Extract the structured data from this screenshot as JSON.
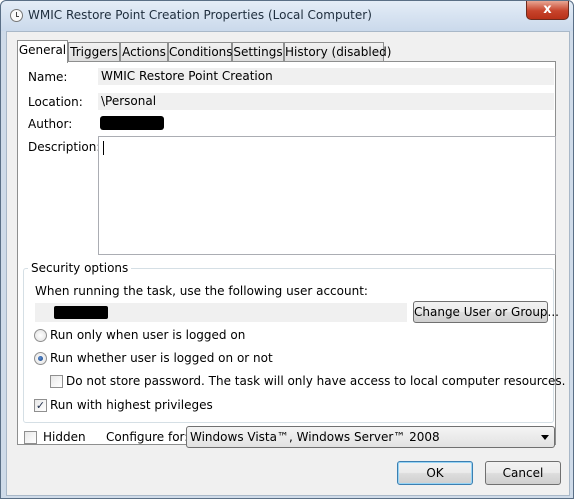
{
  "window": {
    "title": "WMIC Restore Point Creation Properties (Local Computer)",
    "close_glyph": "x",
    "title_icon": "task-clock-icon"
  },
  "tabs": [
    {
      "label": "General",
      "active": true
    },
    {
      "label": "Triggers"
    },
    {
      "label": "Actions"
    },
    {
      "label": "Conditions"
    },
    {
      "label": "Settings"
    },
    {
      "label": "History (disabled)"
    }
  ],
  "general": {
    "name_label": "Name:",
    "name_value": "WMIC Restore Point Creation",
    "location_label": "Location:",
    "location_value": "\\Personal",
    "author_label": "Author:",
    "description_label": "Description:",
    "description_value": ""
  },
  "security": {
    "group_title": "Security options",
    "account_prompt": "When running the task, use the following user account:",
    "change_button": "Change User or Group...",
    "radio_logged_on": "Run only when user is logged on",
    "radio_whether": "Run whether user is logged on or not",
    "selected_run_mode": "whether",
    "no_store_password": "Do not store password.  The task will only have access to local computer resources.",
    "no_store_password_checked": false,
    "highest_privileges": "Run with highest privileges",
    "highest_privileges_checked": true
  },
  "footer": {
    "hidden_label": "Hidden",
    "hidden_checked": false,
    "configure_label": "Configure for:",
    "configure_value": "Windows Vista™, Windows Server™ 2008",
    "ok_button": "OK",
    "cancel_button": "Cancel"
  },
  "colors": {
    "title_bar": "#cad9eb",
    "close_button": "#c7432b",
    "dialog_background": "#f0f0f0",
    "redaction": "#000000"
  }
}
